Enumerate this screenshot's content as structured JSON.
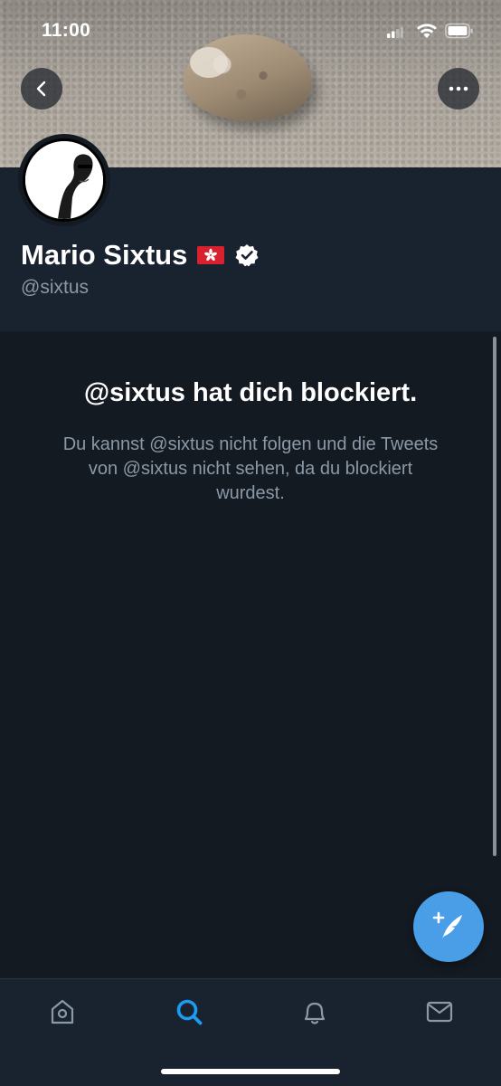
{
  "status_bar": {
    "time": "11:00"
  },
  "header": {
    "back_icon": "chevron-left-icon",
    "more_icon": "ellipsis-icon"
  },
  "profile": {
    "display_name": "Mario Sixtus",
    "flag_icon": "hong-kong-flag-icon",
    "verified_icon": "verified-badge-icon",
    "handle": "@sixtus"
  },
  "blocked": {
    "title": "@sixtus hat dich blockiert.",
    "description": "Du kannst @sixtus nicht folgen und die Tweets von @sixtus nicht sehen, da du blockiert wurdest."
  },
  "fab": {
    "icon": "compose-tweet-icon"
  },
  "bottom_nav": {
    "items": [
      {
        "icon": "home-icon",
        "active": false
      },
      {
        "icon": "search-icon",
        "active": true
      },
      {
        "icon": "bell-icon",
        "active": false
      },
      {
        "icon": "mail-icon",
        "active": false
      }
    ]
  },
  "colors": {
    "accent": "#1d9bf0",
    "fab": "#4a9ee8",
    "background": "#141a22",
    "panel": "#192330",
    "secondary_text": "#8b98a5",
    "flag_red": "#d8202f"
  }
}
